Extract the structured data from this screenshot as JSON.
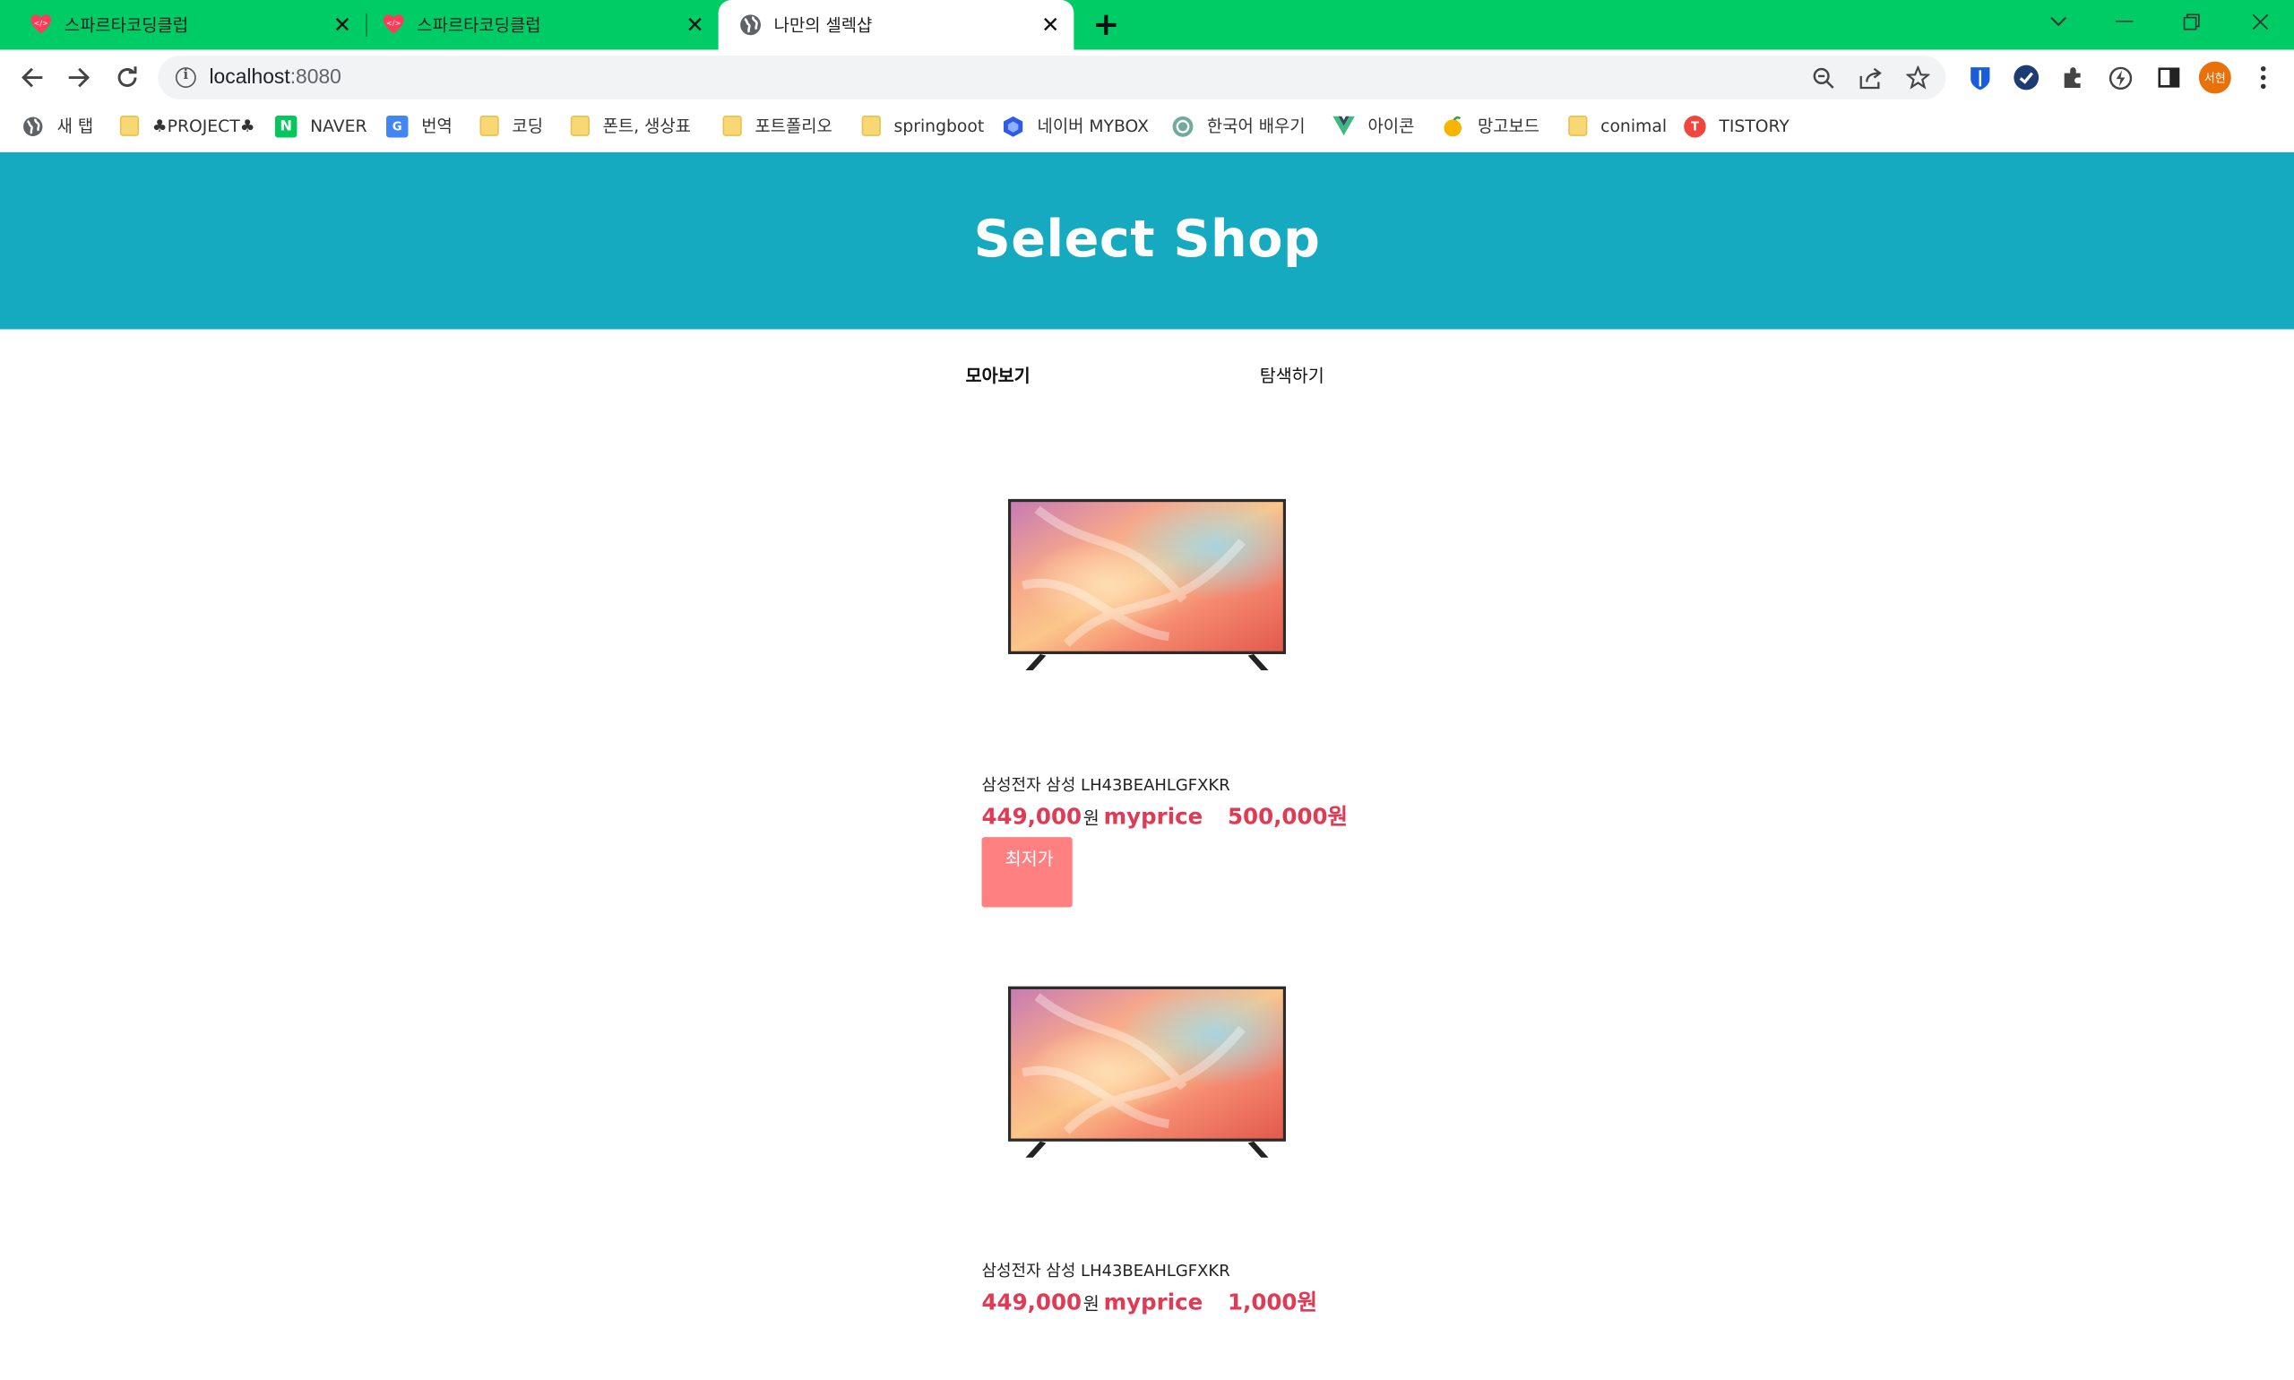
{
  "browser": {
    "tabs": [
      {
        "title": "스파르타코딩클럽",
        "favicon": "sparta-icon"
      },
      {
        "title": "스파르타코딩클럽",
        "favicon": "sparta-icon"
      },
      {
        "title": "나만의 셀렉샵",
        "favicon": "globe-icon",
        "active": true
      }
    ],
    "new_tab": "+",
    "url_host": "localhost",
    "url_port": ":8080",
    "avatar": "서현",
    "accent_color": "#00cc66"
  },
  "bookmarks": [
    {
      "label": "새 탭",
      "icon": "globe-icon"
    },
    {
      "label": "♣PROJECT♣",
      "icon": "folder-icon"
    },
    {
      "label": "NAVER",
      "icon": "naver-icon"
    },
    {
      "label": "번역",
      "icon": "translate-icon"
    },
    {
      "label": "코딩",
      "icon": "folder-icon"
    },
    {
      "label": "폰트, 생상표",
      "icon": "folder-icon"
    },
    {
      "label": "포트폴리오",
      "icon": "folder-icon"
    },
    {
      "label": "springboot",
      "icon": "folder-icon"
    },
    {
      "label": "네이버 MYBOX",
      "icon": "mybox-icon"
    },
    {
      "label": "한국어 배우기",
      "icon": "openai-icon"
    },
    {
      "label": "아이콘",
      "icon": "vue-icon"
    },
    {
      "label": "망고보드",
      "icon": "mango-icon"
    },
    {
      "label": "conimal",
      "icon": "folder-icon"
    },
    {
      "label": "TISTORY",
      "icon": "tistory-icon"
    }
  ],
  "page": {
    "title": "Select Shop",
    "header_color": "#15aabf",
    "nav": {
      "collect": "모아보기",
      "search": "탐색하기"
    },
    "products": [
      {
        "name": "삼성전자 삼성 LH43BEAHLGFXKR",
        "lprice": "449,000",
        "won": "원",
        "myprice_label": "myprice",
        "myprice": "500,000원",
        "badge": "최저가"
      },
      {
        "name": "삼성전자 삼성 LH43BEAHLGFXKR",
        "lprice": "449,000",
        "won": "원",
        "myprice_label": "myprice",
        "myprice": "1,000원"
      }
    ],
    "price_color": "#e03a55",
    "badge_color": "#ff8080"
  }
}
